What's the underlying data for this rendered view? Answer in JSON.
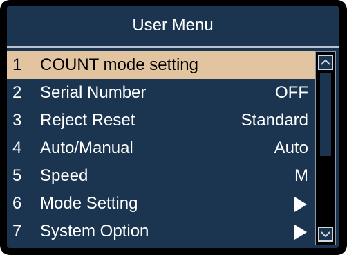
{
  "title": "User Menu",
  "menu": {
    "items": [
      {
        "number": "1",
        "label": "COUNT mode setting",
        "value": "",
        "selected": true
      },
      {
        "number": "2",
        "label": "Serial Number",
        "value": "OFF"
      },
      {
        "number": "3",
        "label": "Reject Reset",
        "value": "Standard"
      },
      {
        "number": "4",
        "label": "Auto/Manual",
        "value": "Auto"
      },
      {
        "number": "5",
        "label": "Speed",
        "value": "M"
      },
      {
        "number": "6",
        "label": "Mode Setting",
        "value": "",
        "submenu_icon": "right-arrow-icon"
      },
      {
        "number": "7",
        "label": "System Option",
        "value": "",
        "submenu_icon": "right-arrow-icon"
      }
    ]
  },
  "scrollbar": {
    "up_icon": "chevron-up-icon",
    "down_icon": "chevron-down-icon"
  },
  "colors": {
    "panel_background": "#1b3550",
    "selected_row": "#e3c4a1",
    "text": "#ffffff",
    "selected_text": "#000000"
  }
}
